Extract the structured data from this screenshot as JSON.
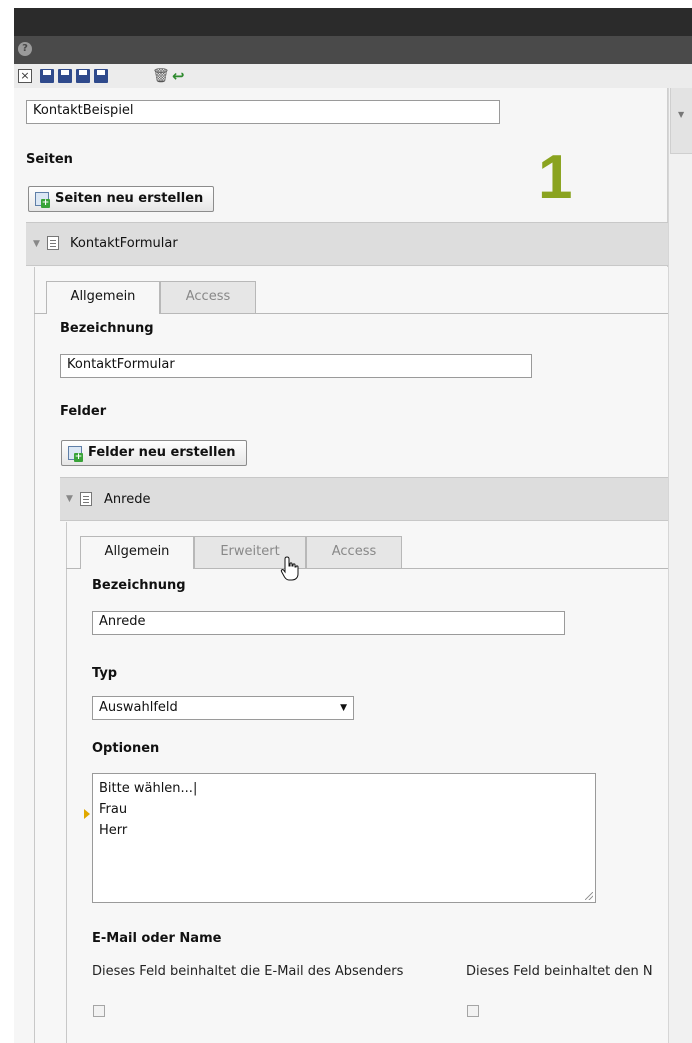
{
  "header": {
    "help_glyph": "?"
  },
  "toolbar": {
    "icons": [
      "close-icon",
      "save-icon",
      "save-view-icon",
      "save-close-icon",
      "save-new-icon",
      "trash-icon",
      "undo-icon"
    ]
  },
  "form": {
    "name_value": "KontaktBeispiel",
    "overlay_number": "1",
    "seiten": {
      "heading": "Seiten",
      "create_button": "Seiten neu erstellen",
      "page": {
        "title": "KontaktFormular",
        "tabs": [
          "Allgemein",
          "Access"
        ],
        "active_tab": "Allgemein",
        "bezeichnung_label": "Bezeichnung",
        "bezeichnung_value": "KontaktFormular",
        "felder": {
          "heading": "Felder",
          "create_button": "Felder neu erstellen",
          "field": {
            "title": "Anrede",
            "tabs": [
              "Allgemein",
              "Erweitert",
              "Access"
            ],
            "active_tab": "Allgemein",
            "bezeichnung_label": "Bezeichnung",
            "bezeichnung_value": "Anrede",
            "typ_label": "Typ",
            "typ_value": "Auswahlfeld",
            "optionen_label": "Optionen",
            "optionen_lines": [
              "Bitte wählen...|",
              "Frau",
              "Herr"
            ],
            "email_name_label": "E-Mail oder Name",
            "email_checkbox_label": "Dieses Feld beinhaltet die E-Mail des Absenders",
            "name_checkbox_label": "Dieses Feld beinhaltet den N"
          }
        }
      }
    }
  }
}
